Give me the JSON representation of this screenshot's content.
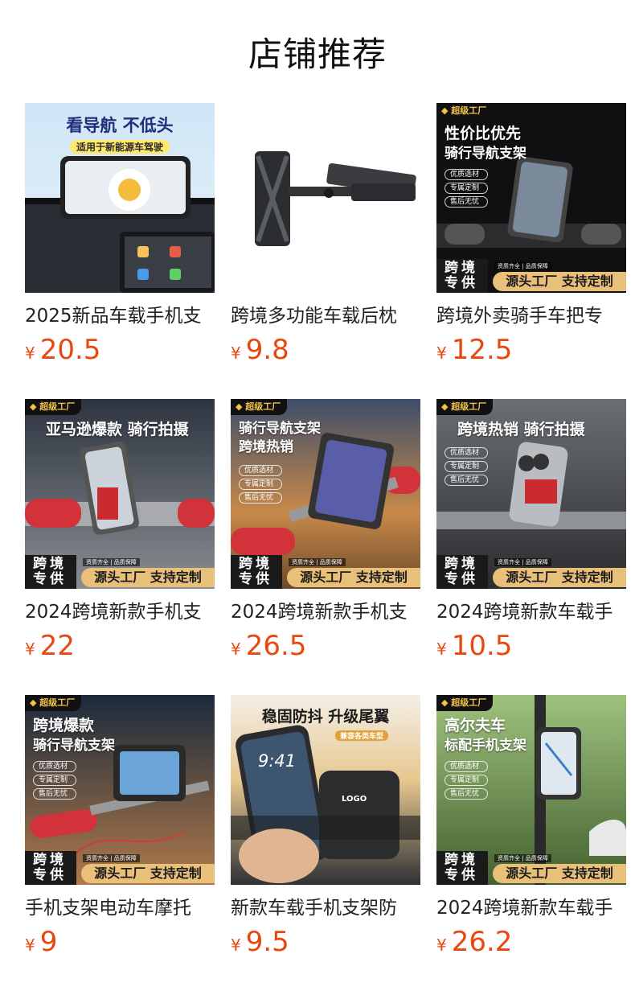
{
  "header": {
    "title": "店铺推荐"
  },
  "currency_symbol": "¥",
  "overlay": {
    "badge": "超级工厂",
    "cross_border": "跨境",
    "exclusive": "专供",
    "factory": "源头工厂 支持定制",
    "mini": "资质齐全 | 品质保障",
    "features": [
      "优质选材",
      "专属定制",
      "售后无忧"
    ]
  },
  "products": [
    {
      "name": "2025新品车载手机支",
      "price": "20.5",
      "img_text": [
        "看导航 不低头",
        "适用于新能源车驾驶"
      ]
    },
    {
      "name": "跨境多功能车载后枕",
      "price": "9.8",
      "img_text": []
    },
    {
      "name": "跨境外卖骑手车把专",
      "price": "12.5",
      "img_text": [
        "性价比优先",
        "骑行导航支架"
      ]
    },
    {
      "name": "2024跨境新款手机支",
      "price": "22",
      "img_text": [
        "亚马逊爆款 骑行拍摄"
      ]
    },
    {
      "name": "2024跨境新款手机支",
      "price": "26.5",
      "img_text": [
        "骑行导航支架",
        "跨境热销"
      ]
    },
    {
      "name": "2024跨境新款车载手",
      "price": "10.5",
      "img_text": [
        "跨境热销 骑行拍摄"
      ]
    },
    {
      "name": "手机支架电动车摩托",
      "price": "9",
      "img_text": [
        "跨境爆款",
        "骑行导航支架"
      ]
    },
    {
      "name": "新款车载手机支架防",
      "price": "9.5",
      "img_text": [
        "稳固防抖 升级尾翼",
        "兼容各类车型",
        "9:41",
        "LOGO"
      ]
    },
    {
      "name": "2024跨境新款车载手",
      "price": "26.2",
      "img_text": [
        "高尔夫车",
        "标配手机支架"
      ]
    }
  ]
}
